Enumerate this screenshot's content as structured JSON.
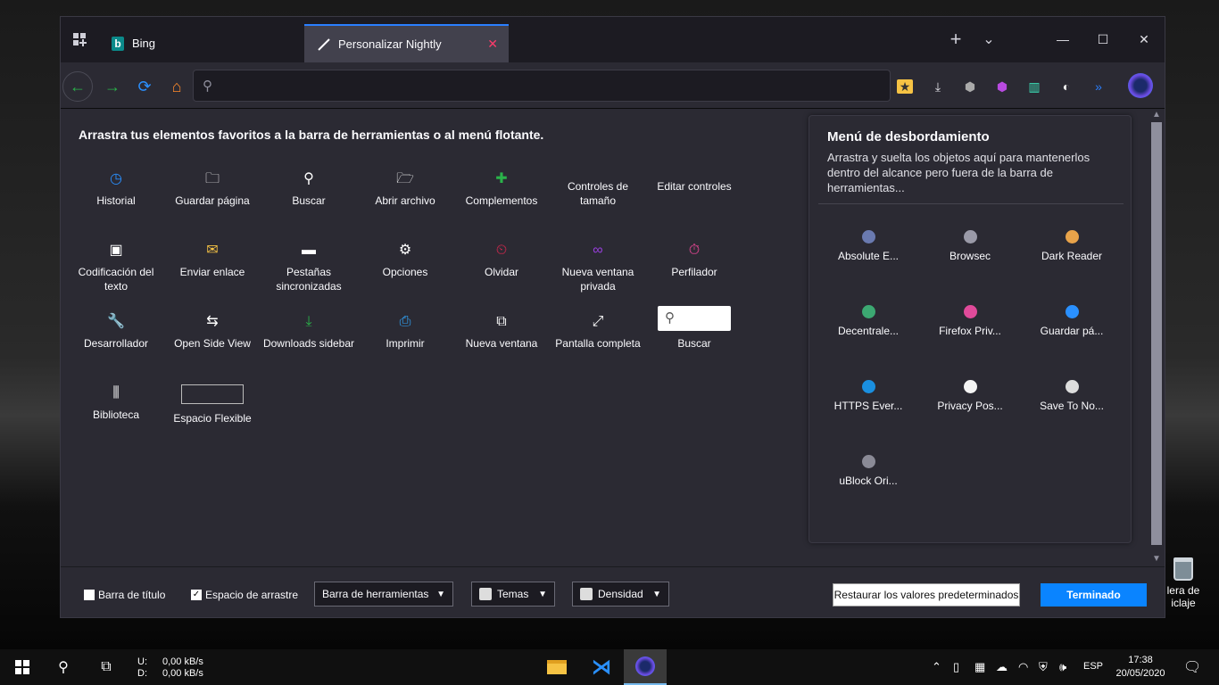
{
  "desktop": {
    "recycle_bin_label_1": "lera de",
    "recycle_bin_label_2": "iclaje"
  },
  "tabs": {
    "bing": "Bing",
    "active": "Personalizar Nightly",
    "new_tab": "+",
    "list_all": "⌄"
  },
  "window_controls": {
    "minimize": "—",
    "maximize": "☐",
    "close": "✕"
  },
  "navbar": {
    "back": "←",
    "forward": "→",
    "reload": "⟳",
    "home": "⌂",
    "url_placeholder": ""
  },
  "palette": {
    "instructions": "Arrastra tus elementos favoritos a la barra de herramientas o al menú flotante.",
    "items": [
      {
        "label": "Historial",
        "icon": "◷",
        "color": "#2a90ff"
      },
      {
        "label": "Guardar página",
        "icon": "🗀",
        "color": "#ffffff"
      },
      {
        "label": "Buscar",
        "icon": "⚲",
        "color": "#ffffff"
      },
      {
        "label": "Abrir archivo",
        "icon": "🗁",
        "color": "#ffffff"
      },
      {
        "label": "Complementos",
        "icon": "✚",
        "color": "#2ab24a"
      },
      {
        "label": "Controles de tamaño",
        "icon": "",
        "color": "#ffffff"
      },
      {
        "label": "Editar controles",
        "icon": "",
        "color": "#ffffff"
      },
      {
        "label": "Codificación del texto",
        "icon": "▣",
        "color": "#ffffff"
      },
      {
        "label": "Enviar enlace",
        "icon": "✉",
        "color": "#f6c344"
      },
      {
        "label": "Pestañas sincronizadas",
        "icon": "▬",
        "color": "#ffffff"
      },
      {
        "label": "Opciones",
        "icon": "⚙",
        "color": "#ffffff"
      },
      {
        "label": "Olvidar",
        "icon": "⏲",
        "color": "#e22850"
      },
      {
        "label": "Nueva ventana privada",
        "icon": "∞",
        "color": "#9a3fe0"
      },
      {
        "label": "Perfilador",
        "icon": "⏱",
        "color": "#ff4aa2"
      },
      {
        "label": "Desarrollador",
        "icon": "🔧",
        "color": "#2a90ff"
      },
      {
        "label": "Open Side View",
        "icon": "⇆",
        "color": "#ffffff"
      },
      {
        "label": "Downloads sidebar",
        "icon": "⤓",
        "color": "#2ab24a"
      },
      {
        "label": "Imprimir",
        "icon": "⎙",
        "color": "#30a8ff"
      },
      {
        "label": "Nueva ventana",
        "icon": "⧉",
        "color": "#ffffff"
      },
      {
        "label": "Pantalla completa",
        "icon": "⤢",
        "color": "#ffffff"
      },
      {
        "label": "Buscar",
        "icon": "⚲",
        "color": "#555555"
      },
      {
        "label": "Biblioteca",
        "icon": "⫼",
        "color": "#ffffff"
      },
      {
        "label": "Espacio Flexible",
        "icon": "",
        "color": "#ffffff"
      }
    ]
  },
  "overflow": {
    "title": "Menú de desbordamiento",
    "description": "Arrastra y suelta los objetos aquí para mantenerlos dentro del alcance pero fuera de la barra de herramientas...",
    "items": [
      {
        "label": "Absolute E...",
        "color": "#6a7ab0"
      },
      {
        "label": "Browsec",
        "color": "#9a9aa8"
      },
      {
        "label": "Dark Reader",
        "color": "#e8a34a"
      },
      {
        "label": "Decentrale...",
        "color": "#3ca872"
      },
      {
        "label": "Firefox Priv...",
        "color": "#e04a9a"
      },
      {
        "label": "Guardar pá...",
        "color": "#2a90ff"
      },
      {
        "label": "HTTPS Ever...",
        "color": "#1a8fe0"
      },
      {
        "label": "Privacy Pos...",
        "color": "#f4f4f4"
      },
      {
        "label": "Save To No...",
        "color": "#dddddd"
      },
      {
        "label": "uBlock Ori...",
        "color": "#8a8a96"
      }
    ]
  },
  "footer": {
    "title_bar": "Barra de título",
    "drag_space": "Espacio de arrastre",
    "toolbars": "Barra de herramientas",
    "themes": "Temas",
    "density": "Densidad",
    "reset": "Restaurar los valores predeterminados",
    "done": "Terminado"
  },
  "taskbar": {
    "up_label": "U:",
    "up_value": "0,00 kB/s",
    "down_label": "D:",
    "down_value": "0,00 kB/s",
    "lang": "ESP",
    "time": "17:38",
    "date": "20/05/2020"
  }
}
